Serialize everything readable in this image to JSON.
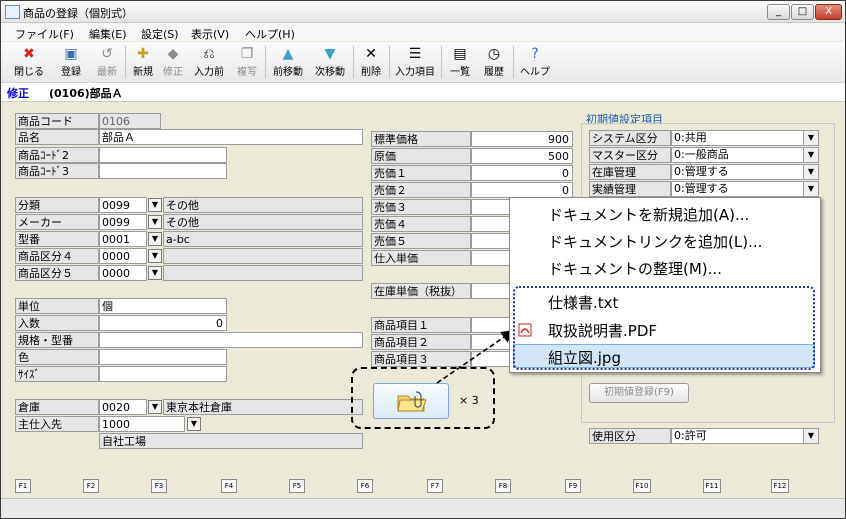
{
  "window": {
    "title": "商品の登録（個別式）",
    "buttons": [
      "_",
      "□",
      "X"
    ]
  },
  "menu": [
    "ファイル(F)",
    "編集(E)",
    "設定(S)",
    "表示(V)",
    "ヘルプ(H)"
  ],
  "toolbar": [
    {
      "label": "閉じる",
      "icon": "close-red-icon",
      "enabled": true
    },
    {
      "label": "登録",
      "icon": "save-icon",
      "enabled": true
    },
    {
      "label": "最新",
      "icon": "latest-icon",
      "enabled": false
    },
    {
      "label": "新規",
      "icon": "new-icon",
      "enabled": true
    },
    {
      "label": "修正",
      "icon": "edit-icon",
      "enabled": false
    },
    {
      "label": "入力前",
      "icon": "revert-icon",
      "enabled": true
    },
    {
      "label": "複写",
      "icon": "copy-icon",
      "enabled": false
    },
    {
      "label": "前移動",
      "icon": "arrow-up-icon",
      "enabled": true
    },
    {
      "label": "次移動",
      "icon": "arrow-down-icon",
      "enabled": true
    },
    {
      "label": "削除",
      "icon": "delete-icon",
      "enabled": true
    },
    {
      "label": "入力項目",
      "icon": "input-items-icon",
      "enabled": true
    },
    {
      "label": "一覧",
      "icon": "list-icon",
      "enabled": true
    },
    {
      "label": "履歴",
      "icon": "history-icon",
      "enabled": true
    },
    {
      "label": "ヘルプ",
      "icon": "help-icon",
      "enabled": true
    }
  ],
  "mode": {
    "label": "修正",
    "record": "(0106)部品Ａ"
  },
  "form": {
    "code": {
      "label": "商品コード",
      "value": "0106"
    },
    "name": {
      "label": "品名",
      "value": "部品Ａ"
    },
    "code2": {
      "label": "商品ｺｰﾄﾞ2",
      "value": ""
    },
    "code3": {
      "label": "商品ｺｰﾄﾞ3",
      "value": ""
    },
    "category": {
      "label": "分類",
      "code": "0099",
      "text": "その他"
    },
    "maker": {
      "label": "メーカー",
      "code": "0099",
      "text": "その他"
    },
    "model": {
      "label": "型番",
      "code": "0001",
      "text": "a-bc"
    },
    "class4": {
      "label": "商品区分４",
      "code": "0000",
      "text": ""
    },
    "class5": {
      "label": "商品区分５",
      "code": "0000",
      "text": ""
    },
    "unit": {
      "label": "単位",
      "value": "個"
    },
    "qty": {
      "label": "入数",
      "value": "0"
    },
    "spec": {
      "label": "規格・型番",
      "value": ""
    },
    "color": {
      "label": "色",
      "value": ""
    },
    "size": {
      "label": "ｻｲｽﾞ",
      "value": ""
    },
    "warehouse": {
      "label": "倉庫",
      "code": "0020",
      "text": "東京本社倉庫"
    },
    "supplier": {
      "label": "主仕入先",
      "code": "1000",
      "text": "自社工場"
    }
  },
  "prices": [
    {
      "label": "標準価格",
      "value": "900"
    },
    {
      "label": "原価",
      "value": "500"
    },
    {
      "label": "売価１",
      "value": "0"
    },
    {
      "label": "売価２",
      "value": "0"
    },
    {
      "label": "売価３",
      "value": ""
    },
    {
      "label": "売価４",
      "value": ""
    },
    {
      "label": "売価５",
      "value": ""
    },
    {
      "label": "仕入単価",
      "value": ""
    }
  ],
  "stock_price": {
    "label": "在庫単価（税抜）",
    "value": ""
  },
  "items": [
    {
      "label": "商品項目１"
    },
    {
      "label": "商品項目２"
    },
    {
      "label": "商品項目３"
    }
  ],
  "defaults": {
    "title": "初期値設定項目",
    "rows": [
      {
        "label": "システム区分",
        "value": "0:共用"
      },
      {
        "label": "マスター区分",
        "value": "0:一般商品"
      },
      {
        "label": "在庫管理",
        "value": "0:管理する"
      },
      {
        "label": "実績管理",
        "value": "0:管理する"
      }
    ],
    "register_button": "初期値登録(F9)"
  },
  "usage": {
    "label": "使用区分",
    "value": "0:許可"
  },
  "context_menu": {
    "items": [
      "ドキュメントを新規追加(A)...",
      "ドキュメントリンクを追加(L)...",
      "ドキュメントの整理(M)..."
    ],
    "files": [
      {
        "name": "仕様書.txt",
        "icon": "text-file-icon"
      },
      {
        "name": "取扱説明書.PDF",
        "icon": "pdf-icon"
      },
      {
        "name": "組立図.jpg",
        "icon": "image-file-icon"
      }
    ]
  },
  "callout": {
    "count_label": "× 3"
  },
  "fkeys": [
    "F1",
    "F2",
    "F3",
    "F4",
    "F5",
    "F6",
    "F7",
    "F8",
    "F9",
    "F10",
    "F11",
    "F12"
  ]
}
